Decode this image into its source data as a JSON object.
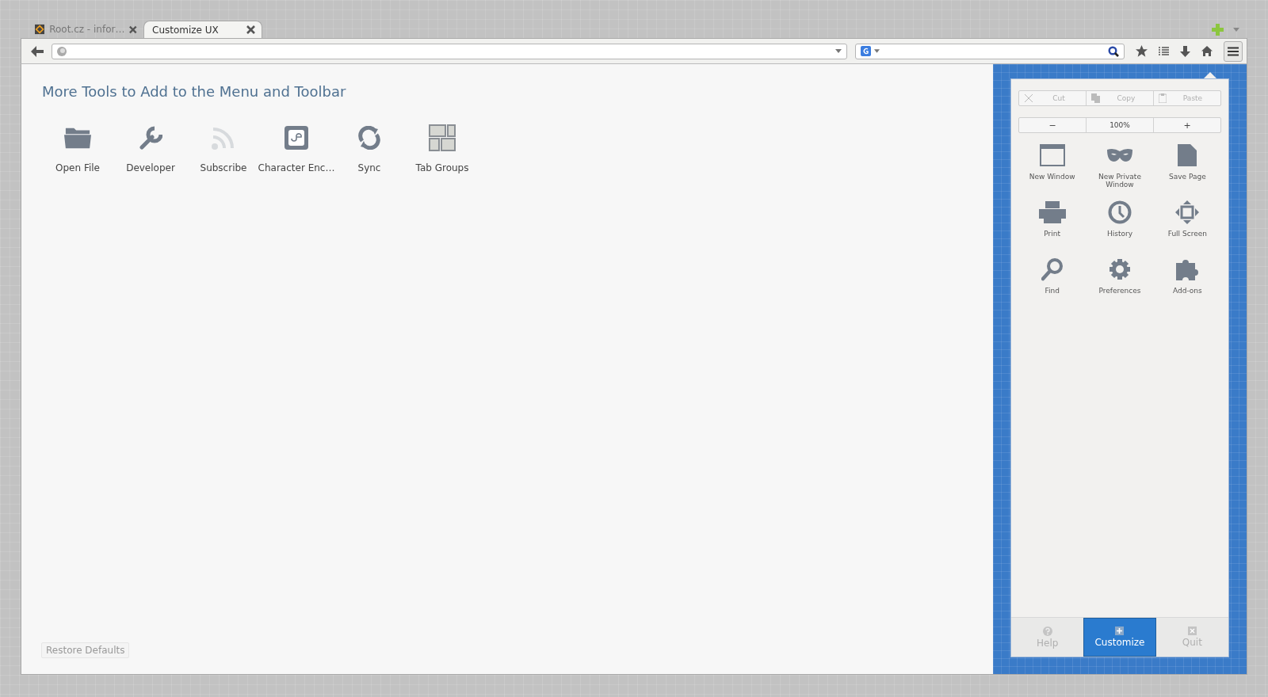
{
  "tabs": [
    {
      "title": "Root.cz - infor…",
      "selected": false
    },
    {
      "title": "Customize UX",
      "selected": true
    }
  ],
  "palette": {
    "heading": "More Tools to Add to the Menu and Toolbar",
    "items": [
      {
        "label": "Open File",
        "disabled": false
      },
      {
        "label": "Developer",
        "disabled": false
      },
      {
        "label": "Subscribe",
        "disabled": true
      },
      {
        "label": "Character Enc…",
        "disabled": false
      },
      {
        "label": "Sync",
        "disabled": false
      },
      {
        "label": "Tab Groups",
        "disabled": false
      }
    ],
    "restore_button": "Restore Defaults"
  },
  "menu": {
    "edit_buttons": [
      {
        "label": "Cut",
        "disabled": true
      },
      {
        "label": "Copy",
        "disabled": true
      },
      {
        "label": "Paste",
        "disabled": true
      }
    ],
    "zoom": {
      "zoom_out": "−",
      "level": "100%",
      "zoom_in": "+"
    },
    "items": [
      {
        "label": "New Window"
      },
      {
        "label": "New Private Window"
      },
      {
        "label": "Save Page"
      },
      {
        "label": "Print"
      },
      {
        "label": "History"
      },
      {
        "label": "Full Screen"
      },
      {
        "label": "Find"
      },
      {
        "label": "Preferences"
      },
      {
        "label": "Add-ons"
      }
    ],
    "footer": [
      {
        "label": "Help",
        "selected": false,
        "disabled": true
      },
      {
        "label": "Customize",
        "selected": true,
        "disabled": false
      },
      {
        "label": "Quit",
        "selected": false,
        "disabled": true
      }
    ]
  }
}
